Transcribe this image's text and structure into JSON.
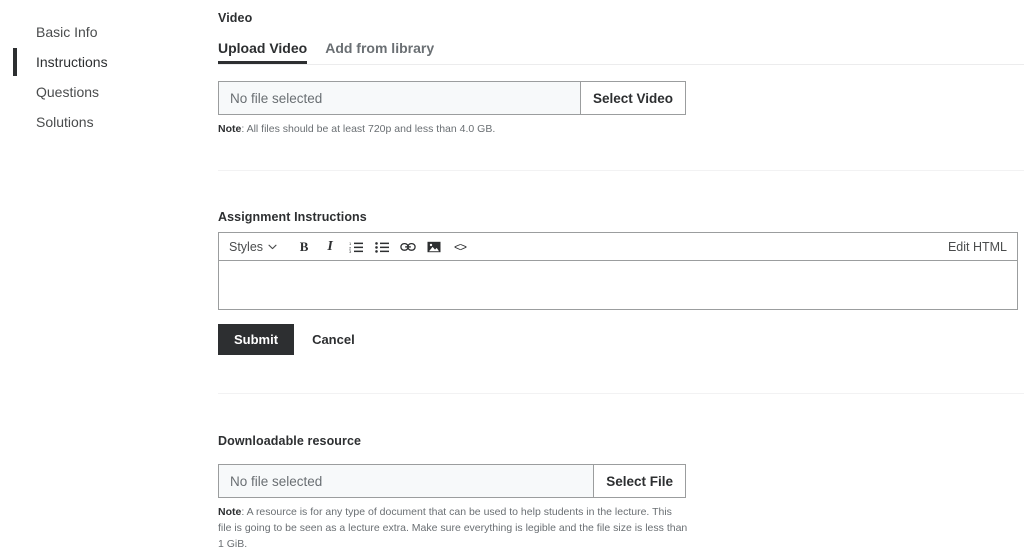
{
  "sidebar": {
    "items": [
      {
        "label": "Basic Info",
        "active": false
      },
      {
        "label": "Instructions",
        "active": true
      },
      {
        "label": "Questions",
        "active": false
      },
      {
        "label": "Solutions",
        "active": false
      }
    ]
  },
  "video_section": {
    "label": "Video",
    "tabs": [
      {
        "label": "Upload Video",
        "active": true
      },
      {
        "label": "Add from library",
        "active": false
      }
    ],
    "file_picker": {
      "file_name": "No file selected",
      "button_label": "Select Video"
    },
    "note_prefix": "Note",
    "note_text": ": All files should be at least 720p and less than 4.0 GB."
  },
  "instructions_section": {
    "label": "Assignment Instructions",
    "toolbar": {
      "styles_label": "Styles",
      "chevron": "⌄",
      "bold_label": "B",
      "italic_label": "I",
      "ordered_list_icon": "ordered-list-icon",
      "unordered_list_icon": "unordered-list-icon",
      "link_icon": "link-icon",
      "image_icon": "image-icon",
      "code_label": "<>",
      "edit_html_label": "Edit HTML"
    },
    "content": "",
    "submit_label": "Submit",
    "cancel_label": "Cancel"
  },
  "resource_section": {
    "label": "Downloadable resource",
    "file_picker": {
      "file_name": "No file selected",
      "button_label": "Select File"
    },
    "note_prefix": "Note",
    "note_text": ": A resource is for any type of document that can be used to help students in the lecture. This file is going to be seen as a lecture extra. Make sure everything is legible and the file size is less than 1 GiB."
  },
  "colors": {
    "accent": "#2d2f31",
    "muted": "#6a6f73",
    "border": "#9b9d9e",
    "divider": "#f2f2f3",
    "field_bg": "#f7f9fa"
  }
}
